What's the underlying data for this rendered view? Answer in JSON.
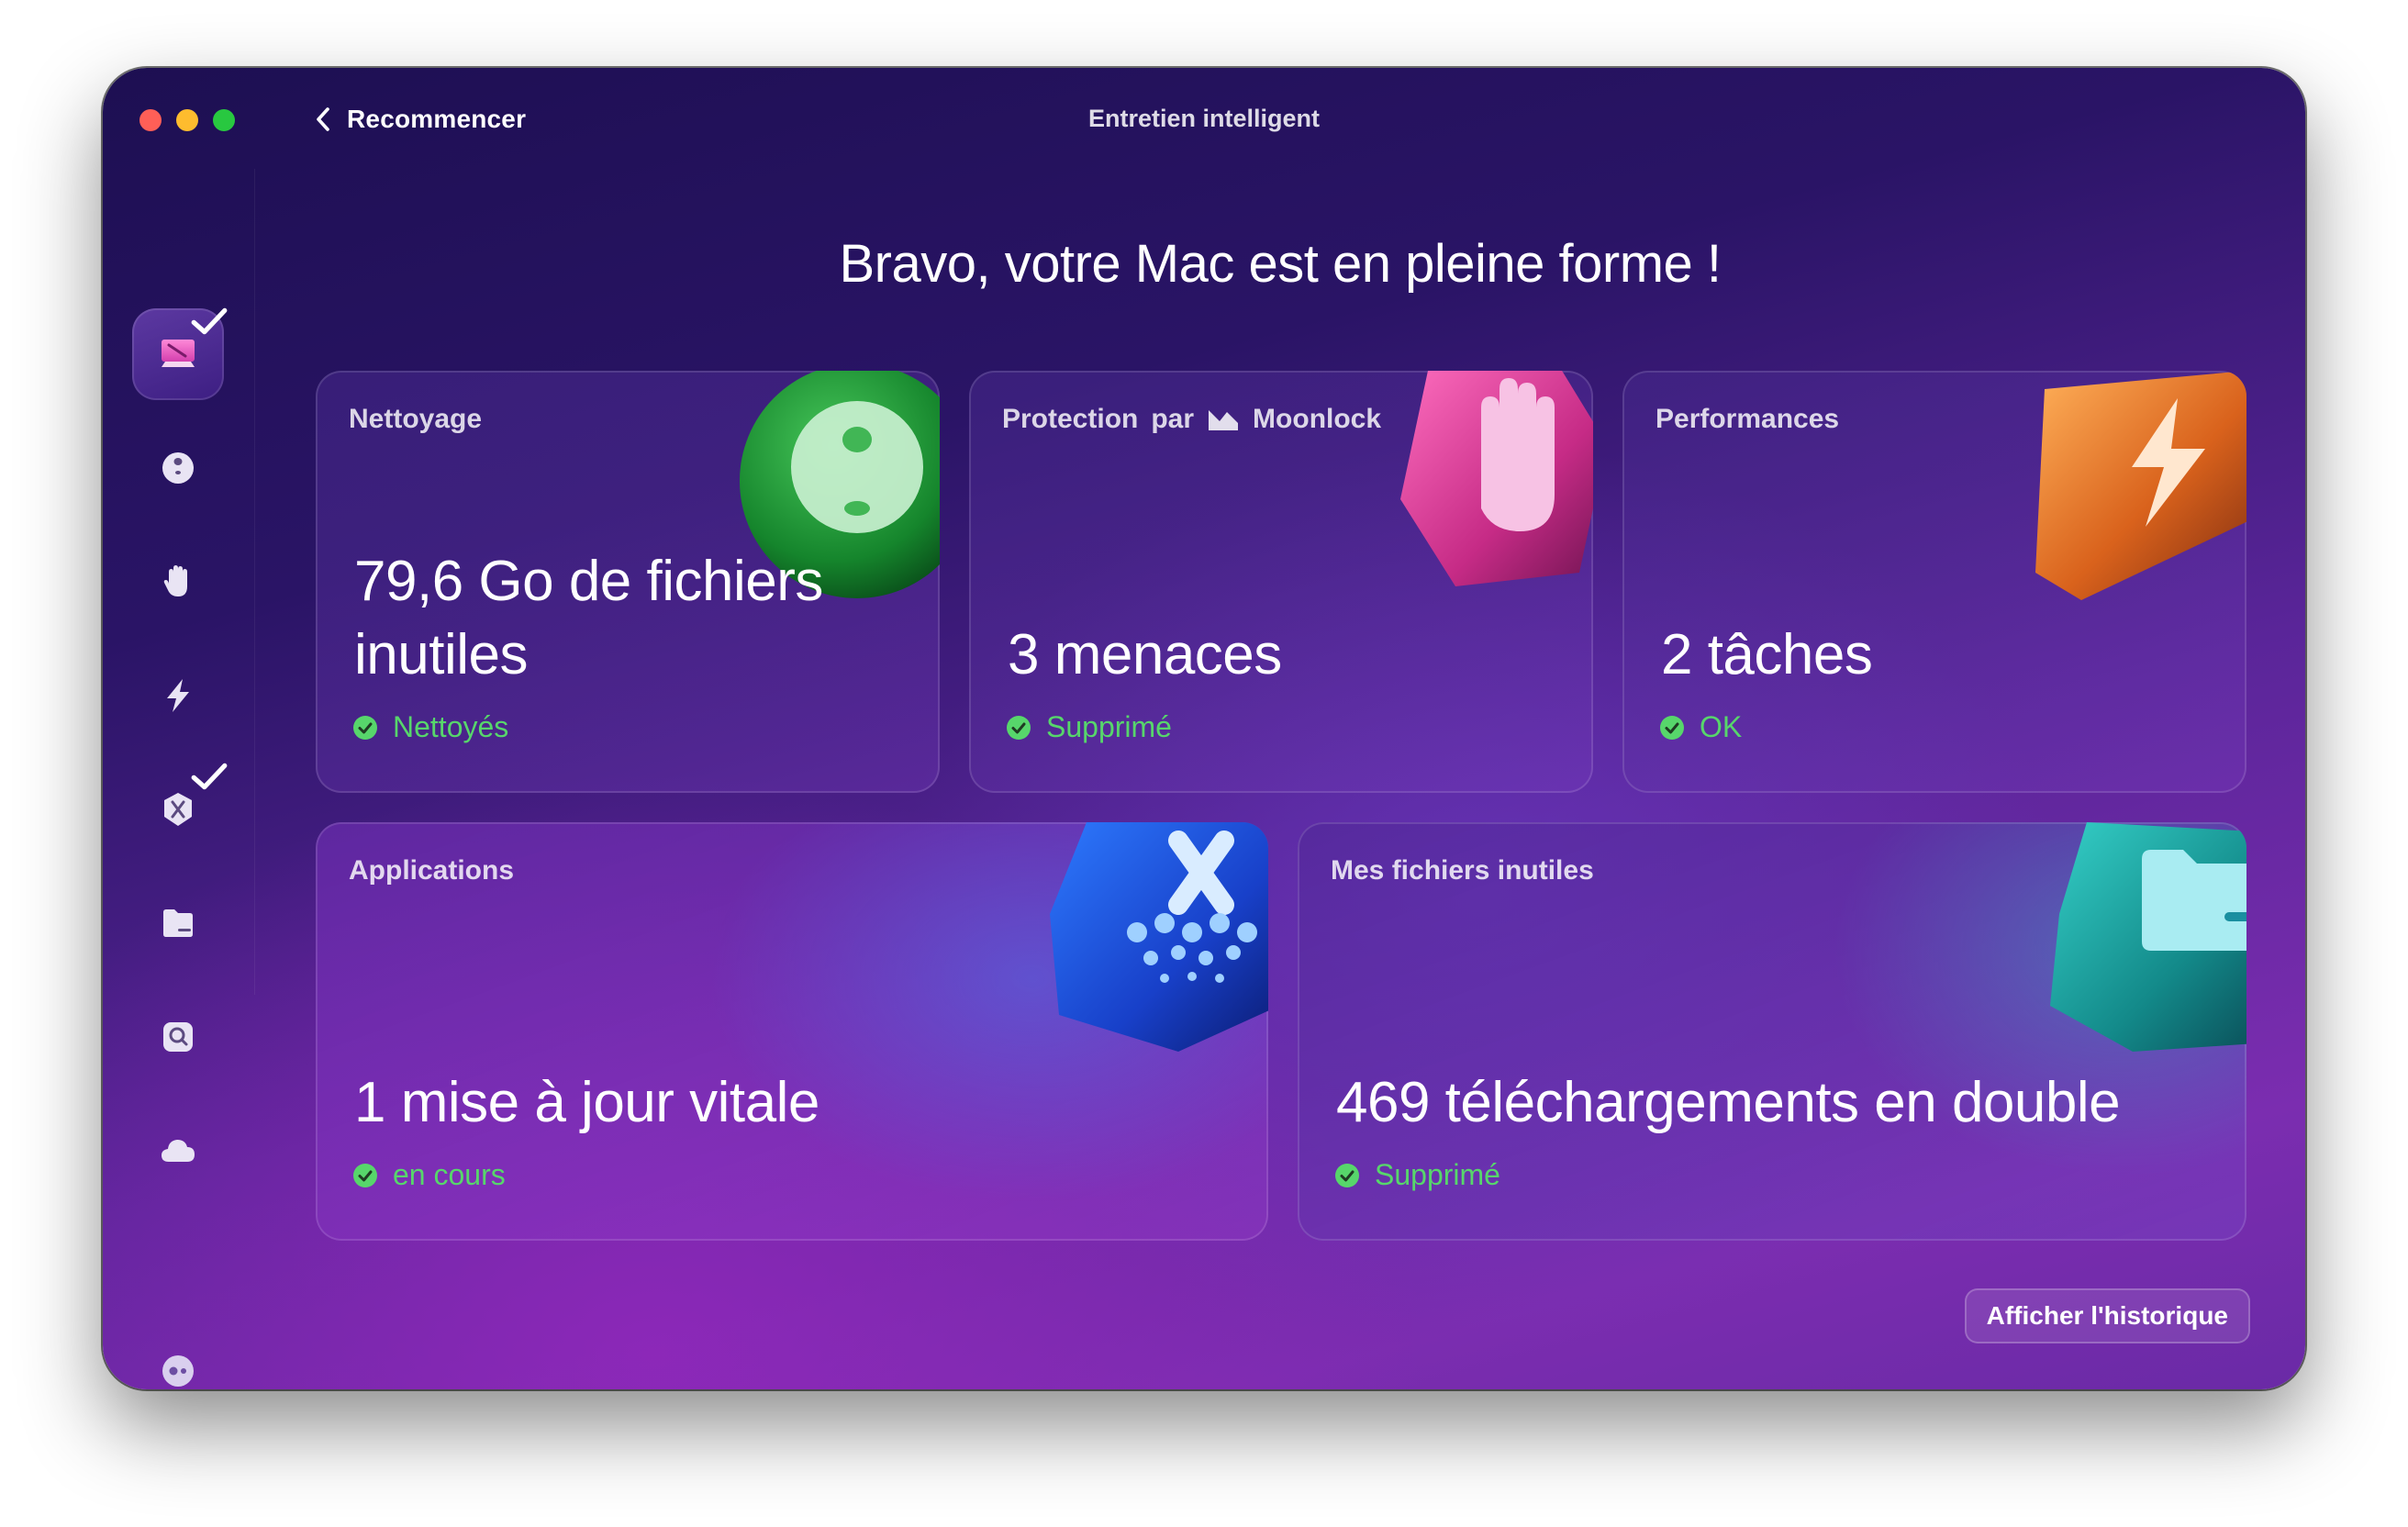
{
  "window": {
    "title": "Entretien intelligent",
    "back_label": "Recommencer"
  },
  "sidebar": {
    "items": [
      {
        "icon": "smart-care-icon",
        "active": true,
        "checked": true
      },
      {
        "icon": "cleanup-icon",
        "checked": false
      },
      {
        "icon": "protection-icon",
        "checked": false
      },
      {
        "icon": "performance-icon",
        "checked": false
      },
      {
        "icon": "applications-icon",
        "checked": true
      },
      {
        "icon": "my-clutter-icon",
        "checked": false
      },
      {
        "icon": "space-lens-icon",
        "checked": false
      },
      {
        "icon": "cloud-icon",
        "checked": false
      }
    ],
    "bottom_icon": "assistant-icon"
  },
  "headline": "Bravo, votre Mac est en pleine forme !",
  "cards": {
    "cleanup": {
      "title": "Nettoyage",
      "value": "79,6 Go de fichiers inutiles",
      "status": "Nettoyés"
    },
    "protection": {
      "title": "Protection",
      "title_by": "par",
      "brand": "Moonlock",
      "value": "3 menaces",
      "status": "Supprimé"
    },
    "performance": {
      "title": "Performances",
      "value": "2 tâches",
      "status": "OK"
    },
    "applications": {
      "title": "Applications",
      "value": "1 mise à jour vitale",
      "status": "en cours"
    },
    "clutter": {
      "title": "Mes fichiers inutiles",
      "value": "469 téléchargements en double",
      "status": "Supprimé"
    }
  },
  "history_button": "Afficher l'historique",
  "colors": {
    "status_green": "#57d66b",
    "close": "#ff5f57",
    "minimize": "#febc2e",
    "zoom": "#28c840"
  }
}
